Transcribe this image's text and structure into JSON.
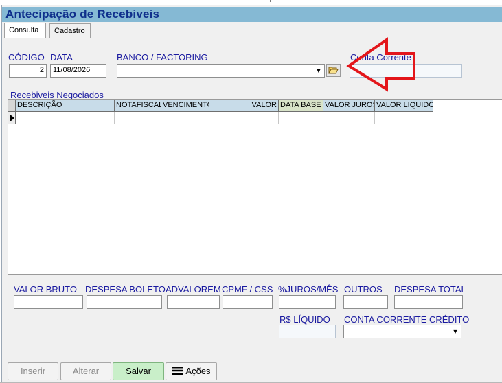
{
  "window": {
    "title": "Antecipação de Recebiveis"
  },
  "tabs": [
    {
      "label": "Consulta",
      "active": true
    },
    {
      "label": "Cadastro",
      "active": false
    }
  ],
  "form": {
    "codigo_label": "CÓDIGO",
    "codigo_value": "2",
    "data_label": "DATA",
    "data_value": "11/08/2026",
    "banco_label": "BANCO / FACTORING",
    "banco_value": "",
    "conta_label": "Conta Corrente",
    "conta_value": ""
  },
  "grid": {
    "title": "Recebiveis Negociados",
    "columns": [
      "DESCRIÇÃO",
      "NOTAFISCAL",
      "VENCIMENTO",
      "VALOR",
      "DATA BASE",
      "VALOR JUROS",
      "VALOR LIQUIDO"
    ]
  },
  "totals": {
    "valor_bruto": "VALOR BRUTO",
    "despesa_boleto": "DESPESA BOLETO",
    "advalorem": "ADVALOREM",
    "cpmf_css": "CPMF / CSS",
    "juros_mes": "%JUROS/MÊS",
    "outros": "OUTROS",
    "despesa_total": "DESPESA TOTAL",
    "rs_liquido": "R$ LÍQUIDO",
    "conta_credito": "CONTA CORRENTE CRÉDITO"
  },
  "buttons": {
    "inserir": "Inserir",
    "alterar": "Alterar",
    "salvar": "Salvar",
    "acoes": "Ações"
  },
  "colors": {
    "titlebar": "#85b9d4",
    "title_text": "#0f2f8c",
    "label_text": "#1a1aa0",
    "annotation_arrow": "#e3161b"
  },
  "icons": {
    "banco_lookup": "folder-open-icon",
    "banco_dropdown": "chevron-down-icon",
    "conta_credito_dropdown": "chevron-down-icon",
    "acoes": "hamburger-menu-icon",
    "row_indicator": "row-pointer-icon"
  }
}
